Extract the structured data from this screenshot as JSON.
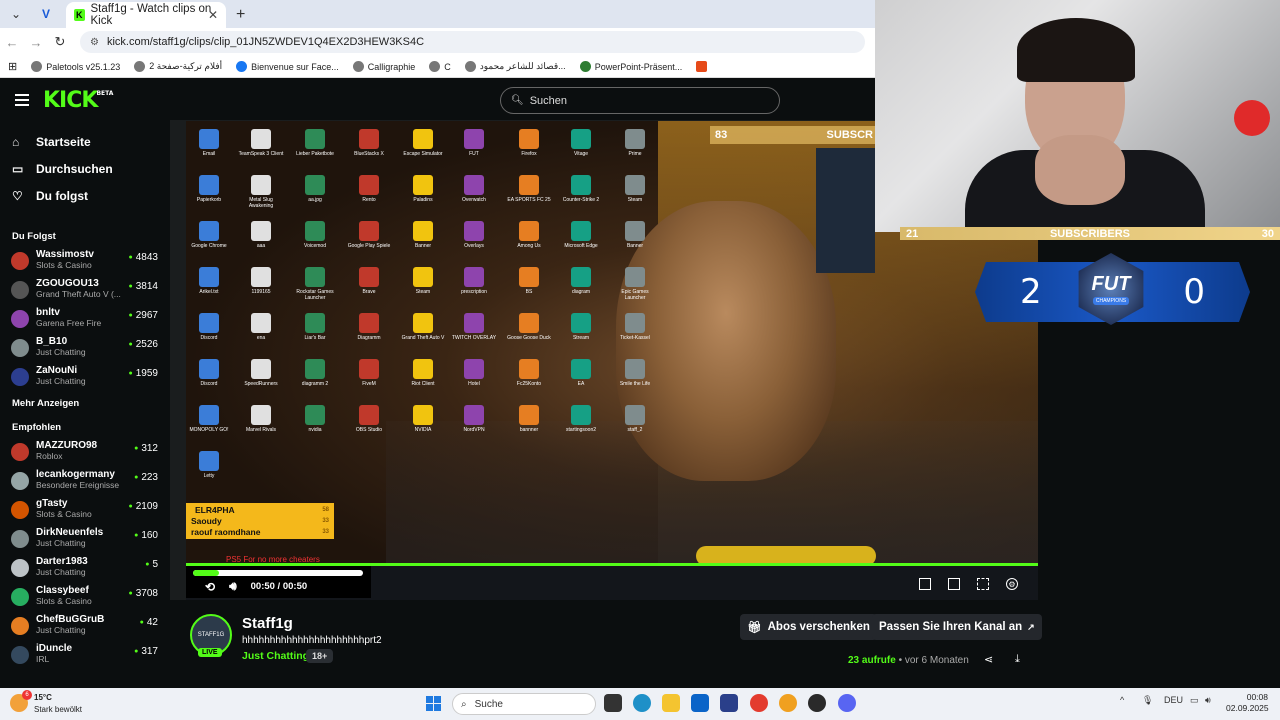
{
  "browser": {
    "tab_title": "Staff1g - Watch clips on Kick",
    "url": "kick.com/staff1g/clips/clip_01JN5ZWDEV1Q4EX2D3HEW3KS4C",
    "bookmarks": [
      "Paletools v25.1.23",
      "أفلام تركية-صفحة 2",
      "Bienvenue sur Face...",
      "Calligraphie",
      "C",
      "قصائد للشاعر محمود...",
      "PowerPoint-Präsent..."
    ]
  },
  "kick": {
    "logo": "KICK",
    "logo_beta": "BETA",
    "search_placeholder": "Suchen"
  },
  "sidebar": {
    "nav": [
      {
        "label": "Startseite",
        "icon": "home-icon"
      },
      {
        "label": "Durchsuchen",
        "icon": "browse-icon"
      },
      {
        "label": "Du folgst",
        "icon": "heart-icon"
      }
    ],
    "following_heading": "Du Folgst",
    "following": [
      {
        "name": "Wassimostv",
        "category": "Slots & Casino",
        "viewers": "4843",
        "color": "#c0392b"
      },
      {
        "name": "ZGOUGOU13",
        "category": "Grand Theft Auto V (...",
        "viewers": "3814",
        "color": "#555555"
      },
      {
        "name": "bnltv",
        "category": "Garena Free Fire",
        "viewers": "2967",
        "color": "#8e44ad"
      },
      {
        "name": "B_B10",
        "category": "Just Chatting",
        "viewers": "2526",
        "color": "#7f8c8d"
      },
      {
        "name": "ZaNouNi",
        "category": "Just Chatting",
        "viewers": "1959",
        "color": "#2c3e90"
      }
    ],
    "show_more": "Mehr Anzeigen",
    "recommended_heading": "Empfohlen",
    "recommended": [
      {
        "name": "MAZZURO98",
        "category": "Roblox",
        "viewers": "312",
        "color": "#c0392b"
      },
      {
        "name": "lecankogermany",
        "category": "Besondere Ereignisse",
        "viewers": "223",
        "color": "#95a5a6"
      },
      {
        "name": "gTasty",
        "category": "Slots & Casino",
        "viewers": "2109",
        "color": "#d35400"
      },
      {
        "name": "DirkNeuenfels",
        "category": "Just Chatting",
        "viewers": "160",
        "color": "#7f8c8d"
      },
      {
        "name": "Darter1983",
        "category": "Just Chatting",
        "viewers": "5",
        "color": "#bdc3c7"
      },
      {
        "name": "Classybeef",
        "category": "Slots & Casino",
        "viewers": "3708",
        "color": "#27ae60"
      },
      {
        "name": "ChefBuGGruB",
        "category": "Just Chatting",
        "viewers": "42",
        "color": "#e67e22"
      },
      {
        "name": "iDuncle",
        "category": "IRL",
        "viewers": "317",
        "color": "#34495e"
      }
    ]
  },
  "stream_overlay": {
    "sub_count": "83",
    "sub_label": "SUBSCR",
    "sub_bar_left": "21",
    "sub_bar_label": "SUBSCRIBERS",
    "sub_bar_right": "30",
    "score_left": "2",
    "score_right": "0",
    "fut_label": "FUT",
    "fut_sub": "CHAMPIONS",
    "chat": [
      {
        "user": "ELR4PHA",
        "n": "58"
      },
      {
        "user": "Saoudy",
        "n": "33"
      },
      {
        "user": "raouf raomdhane",
        "n": "33"
      }
    ],
    "ticker": "PS5 For no more cheaters",
    "desktop_icons": [
      "Email",
      "TeamSpeak 3 Client",
      "Lieber Paketbote",
      "BlueStacks X",
      "Escape Simulator",
      "FUT",
      "Firefox",
      "Vitage",
      "Prime",
      "Papierkorb",
      "Metal Slug Awakening",
      "aa.jpg",
      "Rento",
      "Paladins",
      "Overwatch",
      "EA SPORTS FC 25",
      "Counter-Strike 2",
      "Steam",
      "Google Chrome",
      "aaa",
      "Voicemod",
      "Google Play Spiele",
      "Banner",
      "Overlays",
      "Among Us",
      "Microsoft Edge",
      "Banner",
      "Arikel.txt",
      "1199165",
      "Rockstar Games Launcher",
      "Brave",
      "Steam",
      "prescription",
      "BS",
      "diagram",
      "Epic Games Launcher",
      "Discord",
      "ena",
      "Liar's Bar",
      "Diagramm",
      "Grand Theft Auto V",
      "TWITCH OVERLAY",
      "Goose Goose Duck",
      "Stream",
      "Ticket-Kassel",
      "Discord",
      "SpeedRunners",
      "diagramm 2",
      "FiveM",
      "Riot Client",
      "Hotel",
      "Fc25Konto",
      "EA",
      "Smile the Life",
      "MONOPOLY GO!",
      "Marvel Rivals",
      "nvidia",
      "OBS Studio",
      "NVIDIA",
      "NordVPN",
      "bannner",
      "startingsoon2",
      "staff_2",
      "Letty"
    ]
  },
  "player": {
    "time": "00:50 / 00:50",
    "progress": 0.15
  },
  "clip": {
    "channel": "Staff1g",
    "avatar_text": "STAFF1G",
    "live_label": "LIVE",
    "title": "hhhhhhhhhhhhhhhhhhhhhhprt2",
    "category": "Just Chatting",
    "age_rating": "18+",
    "gift_button": "Abos verschenken",
    "customize_button": "Passen Sie Ihren Kanal an",
    "views_count": "23",
    "views_label": "aufrufe",
    "time_ago": "vor 6 Monaten"
  },
  "windows_taskbar": {
    "weather_temp": "15°C",
    "weather_desc": "Stark bewölkt",
    "weather_badge": "6",
    "search_label": "Suche",
    "language": "DEU",
    "time": "00:08",
    "date": "02.09.2025"
  }
}
